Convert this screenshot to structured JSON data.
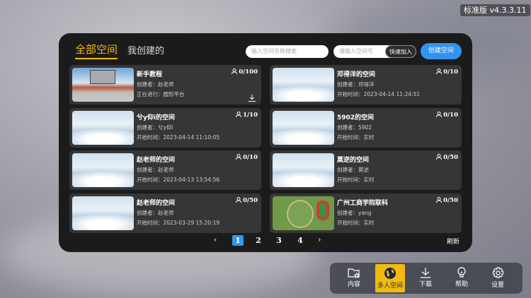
{
  "version": "标准版  v4.3.3.11",
  "tabs": [
    "全部空间",
    "我创建的"
  ],
  "search": {
    "placeholder": "输入空间名称搜索"
  },
  "join": {
    "placeholder": "请输入空间号",
    "button": "快速加入"
  },
  "create_label": "创建空间",
  "cards": [
    {
      "name": "新手教程",
      "l1": "创建者：赵老师",
      "l2": "正在进行：圆形平台",
      "count": "0/100",
      "thumb": "tut"
    },
    {
      "name": "邓得洋的空间",
      "l1": "创建者：邓得洋",
      "l2": "开始时间：2023-04-14 11:24:51",
      "count": "0/10",
      "thumb": "cloud"
    },
    {
      "name": "兮y仰i的空间",
      "l1": "创建者：兮y仰i",
      "l2": "开始时间：2023-04-14 11:10:05",
      "count": "1/10",
      "thumb": "cloud"
    },
    {
      "name": "5902的空间",
      "l1": "创建者：5902",
      "l2": "开始时间：实时",
      "count": "0/10",
      "thumb": "cloud"
    },
    {
      "name": "赵老师的空间",
      "l1": "创建者：赵老师",
      "l2": "开始时间：2023-04-13 13:54:56",
      "count": "0/10",
      "thumb": "cloud"
    },
    {
      "name": "莫逆的空间",
      "l1": "创建者：莫逆",
      "l2": "开始时间：实时",
      "count": "0/50",
      "thumb": "cloud"
    },
    {
      "name": "赵老师的空间",
      "l1": "创建者：赵老师",
      "l2": "开始时间：2023-03-29 15:20:19",
      "count": "0/50",
      "thumb": "cloud"
    },
    {
      "name": "广州工商学院联科",
      "l1": "创建者：yang",
      "l2": "开始时间：实时",
      "count": "0/50",
      "thumb": "map"
    }
  ],
  "pagination": {
    "pages": [
      "1",
      "2",
      "3",
      "4"
    ],
    "current": "1",
    "prev": "‹",
    "next": "›"
  },
  "refresh_label": "刷新",
  "dock": [
    {
      "label": "内容",
      "icon": "folder-star-icon"
    },
    {
      "label": "多人空间",
      "icon": "globe-icon",
      "active": true
    },
    {
      "label": "下载",
      "icon": "download-icon"
    },
    {
      "label": "帮助",
      "icon": "lightbulb-icon"
    },
    {
      "label": "设置",
      "icon": "gear-icon"
    }
  ],
  "colors": {
    "accent": "#f2b90f",
    "primary": "#3394f0",
    "panel": "#1b1b1c",
    "card": "#363636"
  }
}
